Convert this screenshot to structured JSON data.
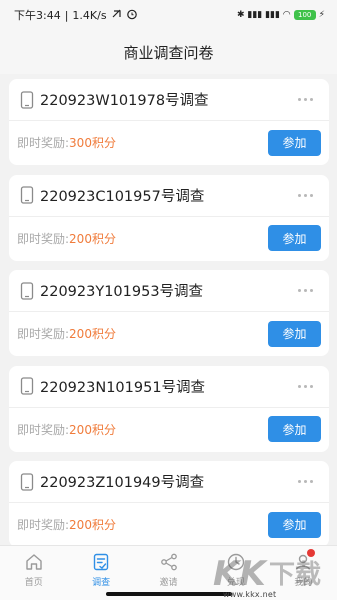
{
  "status_bar": {
    "time": "下午3:44",
    "network_speed": "1.4K/s",
    "right_indicators": "✱ ▮▮▮ ▮▮▮ ◠",
    "battery": "100"
  },
  "header": {
    "title": "商业调查问卷"
  },
  "surveys": [
    {
      "title": "220923W101978号调查",
      "reward_label": "即时奖励:",
      "reward_value": "300积分",
      "join_label": "参加"
    },
    {
      "title": "220923C101957号调查",
      "reward_label": "即时奖励:",
      "reward_value": "200积分",
      "join_label": "参加"
    },
    {
      "title": "220923Y101953号调查",
      "reward_label": "即时奖励:",
      "reward_value": "200积分",
      "join_label": "参加"
    },
    {
      "title": "220923N101951号调查",
      "reward_label": "即时奖励:",
      "reward_value": "200积分",
      "join_label": "参加"
    },
    {
      "title": "220923Z101949号调查",
      "reward_label": "即时奖励:",
      "reward_value": "200积分",
      "join_label": "参加"
    }
  ],
  "tabs": [
    {
      "label": "首页",
      "icon": "home-icon"
    },
    {
      "label": "调查",
      "icon": "survey-icon",
      "active": true
    },
    {
      "label": "邀请",
      "icon": "share-icon"
    },
    {
      "label": "兑现",
      "icon": "clock-icon"
    },
    {
      "label": "我的",
      "icon": "profile-icon"
    }
  ],
  "watermark": {
    "text": "www.kkx.net"
  },
  "colors": {
    "accent": "#2f8fe6",
    "reward": "#f07c3c",
    "background": "#f2f2f2"
  }
}
